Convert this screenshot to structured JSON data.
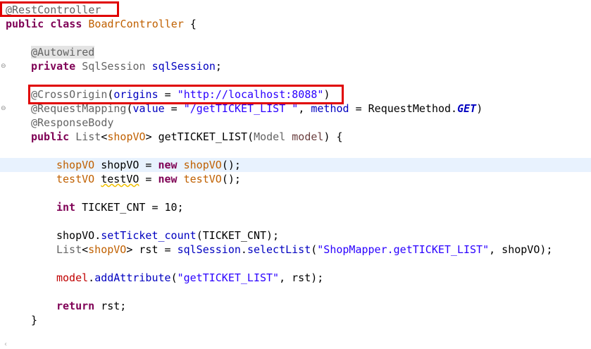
{
  "editor": {
    "lines": {
      "l1": {
        "ann": "@RestController"
      },
      "l2": {
        "kw1": "public",
        "kw2": "class",
        "name": "BoadrController",
        "brace": " {"
      },
      "l4": {
        "ann": "@Autowired"
      },
      "l5": {
        "kw": "private",
        "type": "SqlSession",
        "field": "sqlSession",
        "end": ";"
      },
      "l7": {
        "ann": "@CrossOrigin",
        "open": "(",
        "param": "origins",
        "eq": " = ",
        "str": "\"http://localhost:8088\"",
        "close": ")"
      },
      "l8": {
        "ann": "@RequestMapping",
        "open": "(",
        "p1": "value",
        "eq1": " = ",
        "str": "\"/getTICKET_LIST \"",
        "comma": ", ",
        "p2": "method",
        "eq2": " = ",
        "cls": "RequestMethod.",
        "const": "GET",
        "close": ")"
      },
      "l9": {
        "ann": "@ResponseBody"
      },
      "l10": {
        "kw": "public",
        "type": "List",
        "lt": "<",
        "generic": "shopVO",
        "gt": ">",
        "method": "getTICKET_LIST",
        "open": "(",
        "ptype": "Model",
        "pname": "model",
        "close": ") {"
      },
      "l12": {
        "type": "shopVO",
        "var": "shopVO",
        "eq": " = ",
        "kw": "new",
        "ctor": "shopVO",
        "end": "();"
      },
      "l13": {
        "type": "testVO",
        "var": "testVO",
        "eq": " = ",
        "kw": "new",
        "ctor": "testVO",
        "end": "();"
      },
      "l15": {
        "kw": "int",
        "rest": "TICKET_CNT = 10;"
      },
      "l17": {
        "obj": "shopVO",
        "dot": ".",
        "call": "setTicket_count",
        "args": "(TICKET_CNT);"
      },
      "l18": {
        "type": "List",
        "lt": "<",
        "generic": "shopVO",
        "gt": ">",
        "var": "rst",
        "eq": " = ",
        "field": "sqlSession",
        "dot": ".",
        "call": "selectList",
        "open": "(",
        "str": "\"ShopMapper.getTICKET_LIST\"",
        "rest": ", shopVO);"
      },
      "l20": {
        "obj": "model",
        "dot": ".",
        "call": "addAttribute",
        "open": "(",
        "str": "\"getTICKET_LIST\"",
        "rest": ", rst);"
      },
      "l22": {
        "kw": "return",
        "rest": " rst;"
      },
      "l23": {
        "brace": "}"
      }
    },
    "gutter_marker": "⊖"
  },
  "colors": {
    "keyword": "#7f0055",
    "annotation": "#646464",
    "string": "#2a00ff",
    "field": "#0000c0",
    "highlight_border": "#e00000",
    "current_line": "#e8f2fe"
  }
}
